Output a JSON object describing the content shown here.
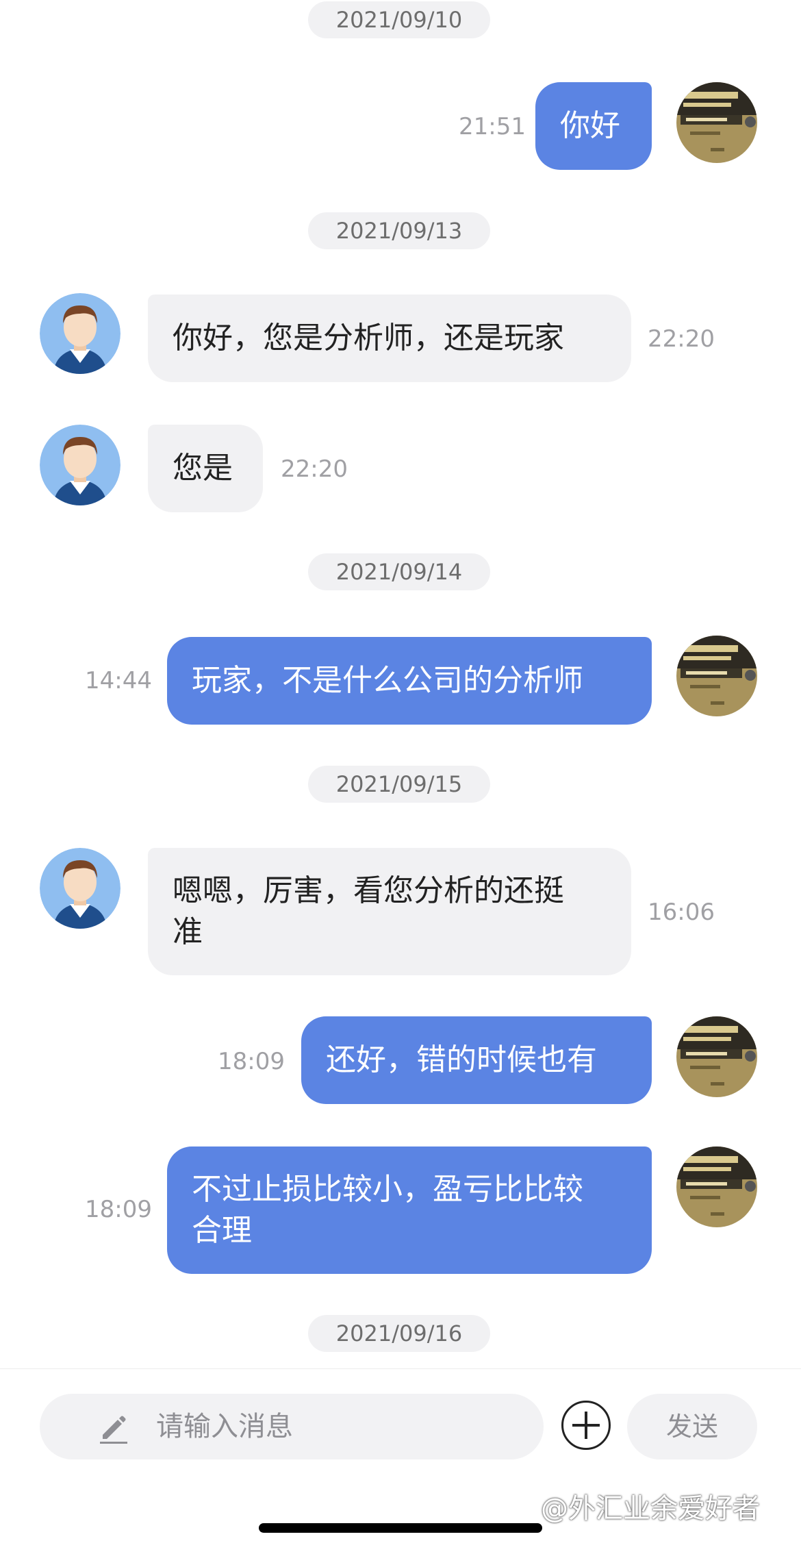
{
  "dates": {
    "d1": "2021/09/10",
    "d2": "2021/09/13",
    "d3": "2021/09/14",
    "d4": "2021/09/15",
    "d5": "2021/09/16"
  },
  "messages": [
    {
      "side": "out",
      "text": "你好",
      "time": "21:51"
    },
    {
      "side": "in",
      "text": "你好，您是分析师，还是玩家",
      "time": "22:20"
    },
    {
      "side": "in",
      "text": "您是",
      "time": "22:20"
    },
    {
      "side": "out",
      "text": "玩家，不是什么公司的分析师",
      "time": "14:44"
    },
    {
      "side": "in",
      "text_line1": "嗯嗯，厉害，看您分析的还挺",
      "text_line2": "准",
      "time": "16:06"
    },
    {
      "side": "out",
      "text": "还好，错的时候也有",
      "time": "18:09"
    },
    {
      "side": "out",
      "text_line1": "不过止损比较小，盈亏比比较",
      "text_line2": "合理",
      "time": "18:09"
    }
  ],
  "input": {
    "placeholder": "请输入消息",
    "send_label": "发送"
  },
  "watermark": "@外汇业余爱好者",
  "icons": {
    "compose": "pencil-icon",
    "add": "plus-icon"
  },
  "colors": {
    "outgoing_bubble": "#5b84e3",
    "incoming_bubble": "#f1f1f3"
  }
}
